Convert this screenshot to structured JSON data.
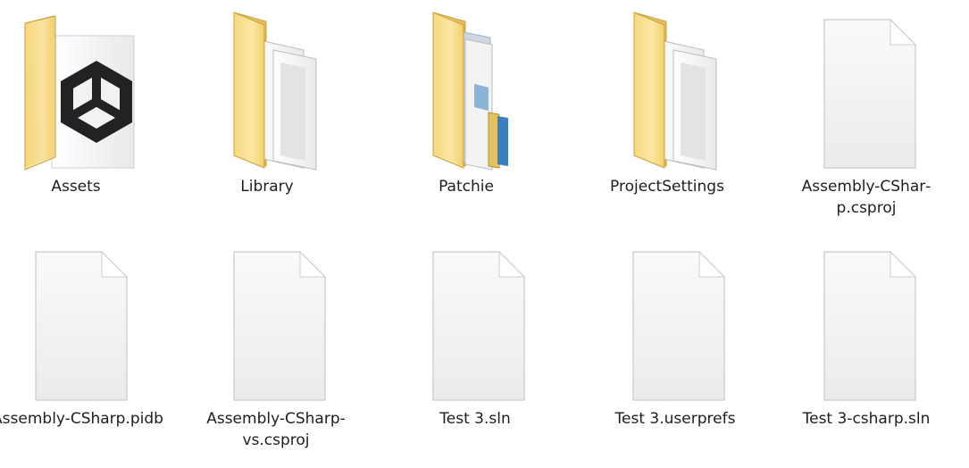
{
  "items": [
    {
      "name": "Assets",
      "type": "folder",
      "icon": "unity-folder-icon"
    },
    {
      "name": "Library",
      "type": "folder",
      "icon": "documents-folder-icon"
    },
    {
      "name": "Patchie",
      "type": "folder",
      "icon": "files-folder-icon"
    },
    {
      "name": "ProjectSettings",
      "type": "folder",
      "icon": "documents-folder-icon"
    },
    {
      "name": "Assembly-CShar­p.csproj",
      "type": "file",
      "icon": "blank-file-icon"
    },
    {
      "name": "Assembly-CShar­p.pidb",
      "type": "file",
      "icon": "blank-file-icon"
    },
    {
      "name": "Assembly-CShar­p-vs.csproj",
      "type": "file",
      "icon": "blank-file-icon"
    },
    {
      "name": "Test 3.sln",
      "type": "file",
      "icon": "blank-file-icon"
    },
    {
      "name": "Test 3.userprefs",
      "type": "file",
      "icon": "blank-file-icon"
    },
    {
      "name": "Test 3-csharp.sln",
      "type": "file",
      "icon": "blank-file-icon"
    }
  ],
  "colors": {
    "folder_back": "#e8c05b",
    "folder_front": "#f8dc8a",
    "folder_edge": "#c9a03c",
    "file_fill": "#f4f4f4",
    "file_edge": "#d2d2d2",
    "label_text": "#1e1e1e"
  }
}
